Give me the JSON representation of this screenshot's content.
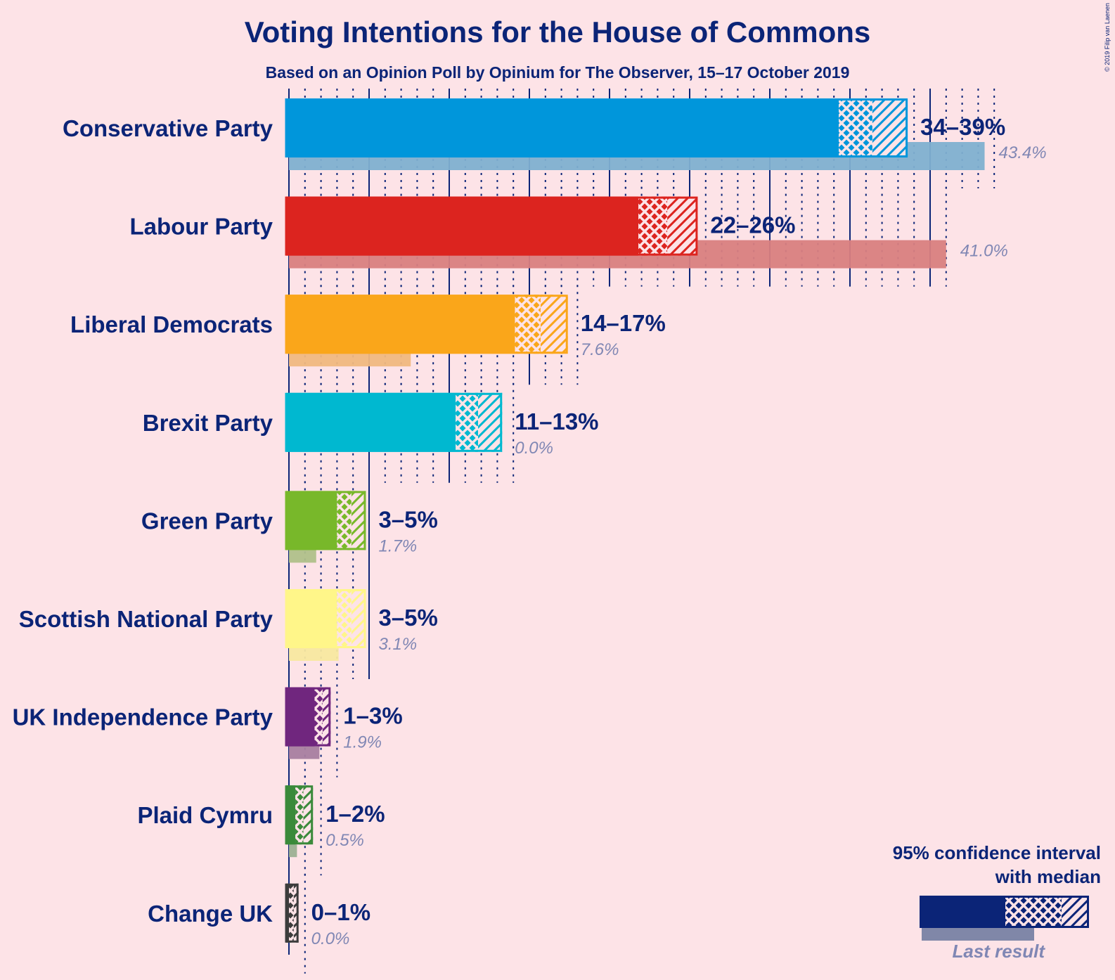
{
  "title": "Voting Intentions for the House of Commons",
  "subtitle": "Based on an Opinion Poll by Opinium for The Observer, 15–17 October 2019",
  "copyright": "© 2019 Filip van Laenen",
  "legend": {
    "line1": "95% confidence interval",
    "line2": "with median",
    "last_result": "Last result",
    "placement": "bottom-right"
  },
  "chart_data": {
    "type": "bar",
    "orientation": "horizontal",
    "title": "Voting Intentions for the House of Commons",
    "subtitle": "Based on an Opinion Poll by Opinium for The Observer, 15–17 October 2019",
    "xlabel": "",
    "ylabel": "",
    "xlim": [
      0,
      45
    ],
    "grid": {
      "major_every": 5,
      "minor_every": 1
    },
    "categories": [
      "Conservative Party",
      "Labour Party",
      "Liberal Democrats",
      "Brexit Party",
      "Green Party",
      "Scottish National Party",
      "UK Independence Party",
      "Plaid Cymru",
      "Change UK"
    ],
    "series": [
      {
        "name": "CI low",
        "values": [
          34.3,
          21.8,
          14.1,
          10.4,
          3.0,
          3.0,
          1.6,
          0.4,
          0.0
        ]
      },
      {
        "name": "Median",
        "values": [
          36.4,
          23.6,
          15.7,
          11.8,
          3.9,
          3.9,
          2.1,
          0.9,
          0.3
        ]
      },
      {
        "name": "CI high",
        "values": [
          38.6,
          25.5,
          17.4,
          13.3,
          4.8,
          4.8,
          2.6,
          1.5,
          0.6
        ]
      },
      {
        "name": "Last result",
        "values": [
          43.4,
          41.0,
          7.6,
          0.0,
          1.7,
          3.1,
          1.9,
          0.5,
          0.0
        ]
      }
    ],
    "ci_labels": [
      "34–39%",
      "22–26%",
      "14–17%",
      "11–13%",
      "3–5%",
      "3–5%",
      "1–3%",
      "1–2%",
      "0–1%"
    ],
    "last_labels": [
      "43.4%",
      "41.0%",
      "7.6%",
      "0.0%",
      "1.7%",
      "3.1%",
      "1.9%",
      "0.5%",
      "0.0%"
    ],
    "colors": [
      "#0096db",
      "#dc241f",
      "#faa61a",
      "#00b8d0",
      "#78b82a",
      "#fff689",
      "#70267e",
      "#3a8a3a",
      "#3c3c3c"
    ],
    "last_colors": [
      "#80b0d0",
      "#d98080",
      "#f0b87f",
      "#80c0d0",
      "#b0c08a",
      "#f8e8a0",
      "#a87ea0",
      "#9cb094",
      "#808080"
    ]
  }
}
